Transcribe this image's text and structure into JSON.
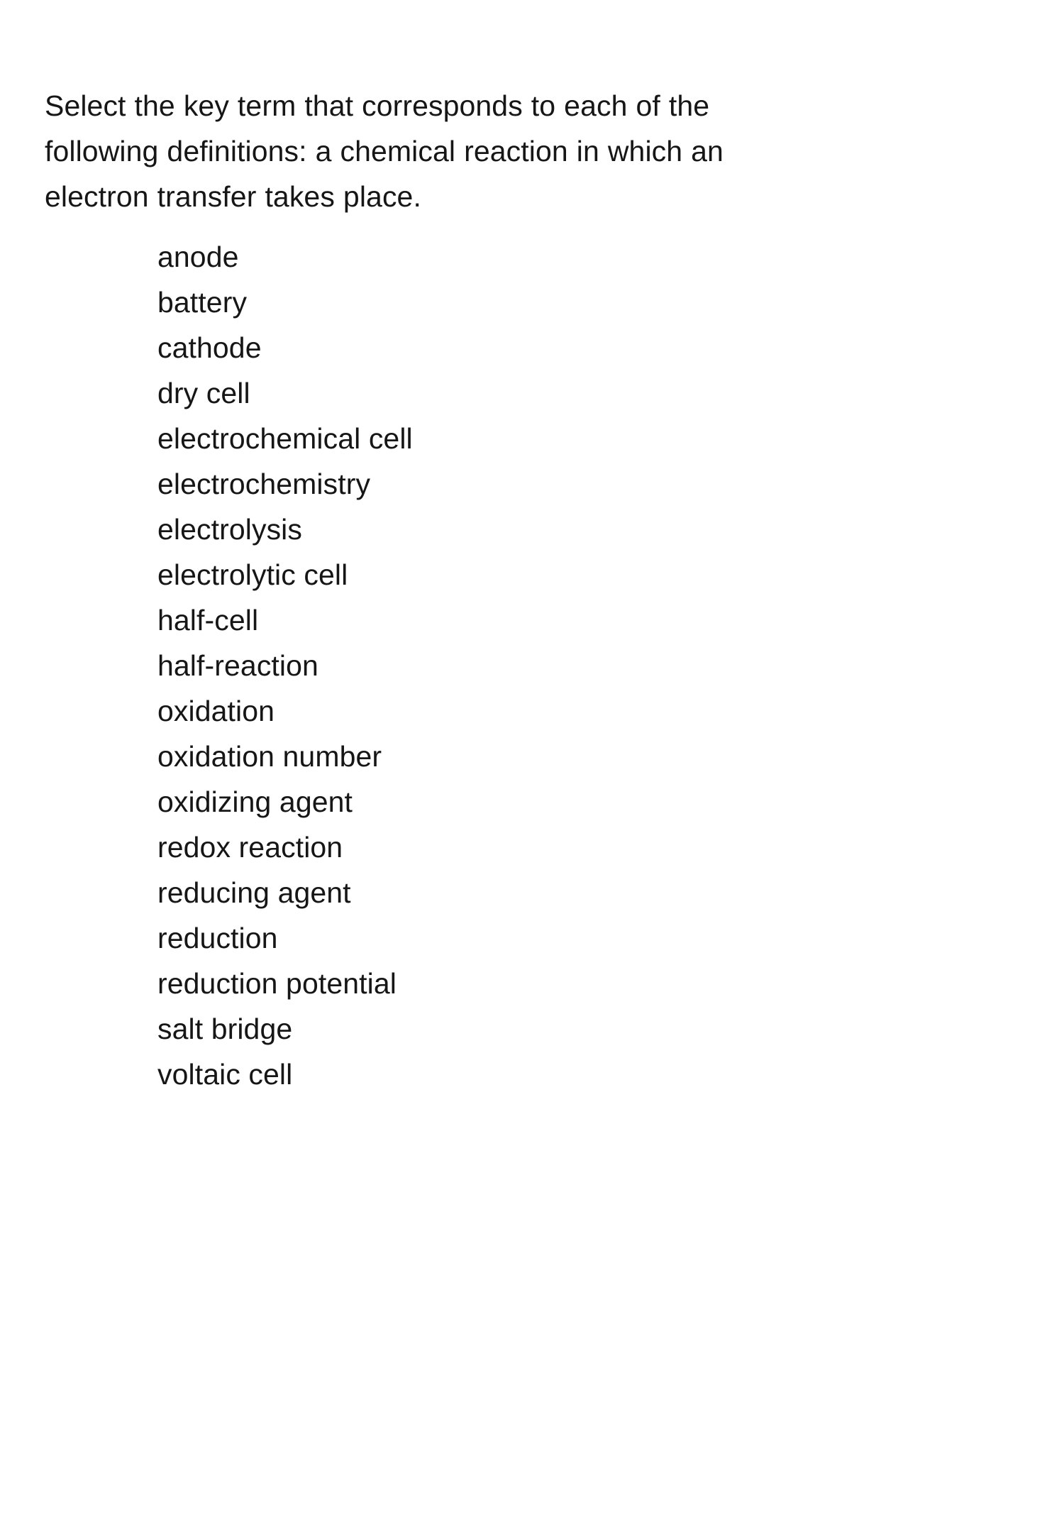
{
  "question": {
    "prompt": "Select the key term that corresponds to each of the following definitions: a chemical reaction in which an electron transfer takes place."
  },
  "options": [
    {
      "label": "anode"
    },
    {
      "label": "battery"
    },
    {
      "label": "cathode"
    },
    {
      "label": "dry cell"
    },
    {
      "label": "electrochemical cell"
    },
    {
      "label": "electrochemistry"
    },
    {
      "label": "electrolysis"
    },
    {
      "label": "electrolytic cell"
    },
    {
      "label": "half-cell"
    },
    {
      "label": "half-reaction"
    },
    {
      "label": "oxidation"
    },
    {
      "label": "oxidation number"
    },
    {
      "label": "oxidizing agent"
    },
    {
      "label": "redox reaction"
    },
    {
      "label": "reducing agent"
    },
    {
      "label": "reduction"
    },
    {
      "label": "reduction potential"
    },
    {
      "label": "salt bridge"
    },
    {
      "label": "voltaic cell"
    }
  ],
  "theme": {
    "background": "#ffffff",
    "text_color": "#161616"
  }
}
